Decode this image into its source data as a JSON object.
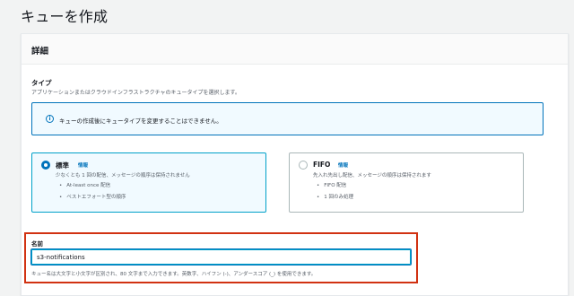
{
  "page": {
    "title": "キューを作成"
  },
  "details": {
    "header": "詳細",
    "type_title": "タイプ",
    "type_description": "アプリケーションまたはクラウドインフラストラクチャのキュータイプを選択します。",
    "info_message": "キューの作成後にキュータイプを変更することはできません。",
    "info_icon": "info-icon",
    "options": [
      {
        "title": "標準",
        "info_link": "情報",
        "description": "少なくとも 1 回の配信、メッセージの順序は保持されません",
        "bullets": [
          "At-least once 配信",
          "ベストエフォート型の順序"
        ],
        "selected": true
      },
      {
        "title": "FIFO",
        "info_link": "情報",
        "description": "先入れ先出し配信、メッセージの順序は保持されます",
        "bullets": [
          "FIFO 配信",
          "1 回のみ処理"
        ],
        "selected": false
      }
    ]
  },
  "name_field": {
    "label": "名前",
    "value": "s3-notifications",
    "hint": "キュー名は大文字と小文字が区別され、80 文字まで入力できます。英数字、ハイフン (-)、アンダースコア (_) を使用できます。"
  },
  "colors": {
    "accent": "#0073bb",
    "highlight": "#d13212"
  }
}
